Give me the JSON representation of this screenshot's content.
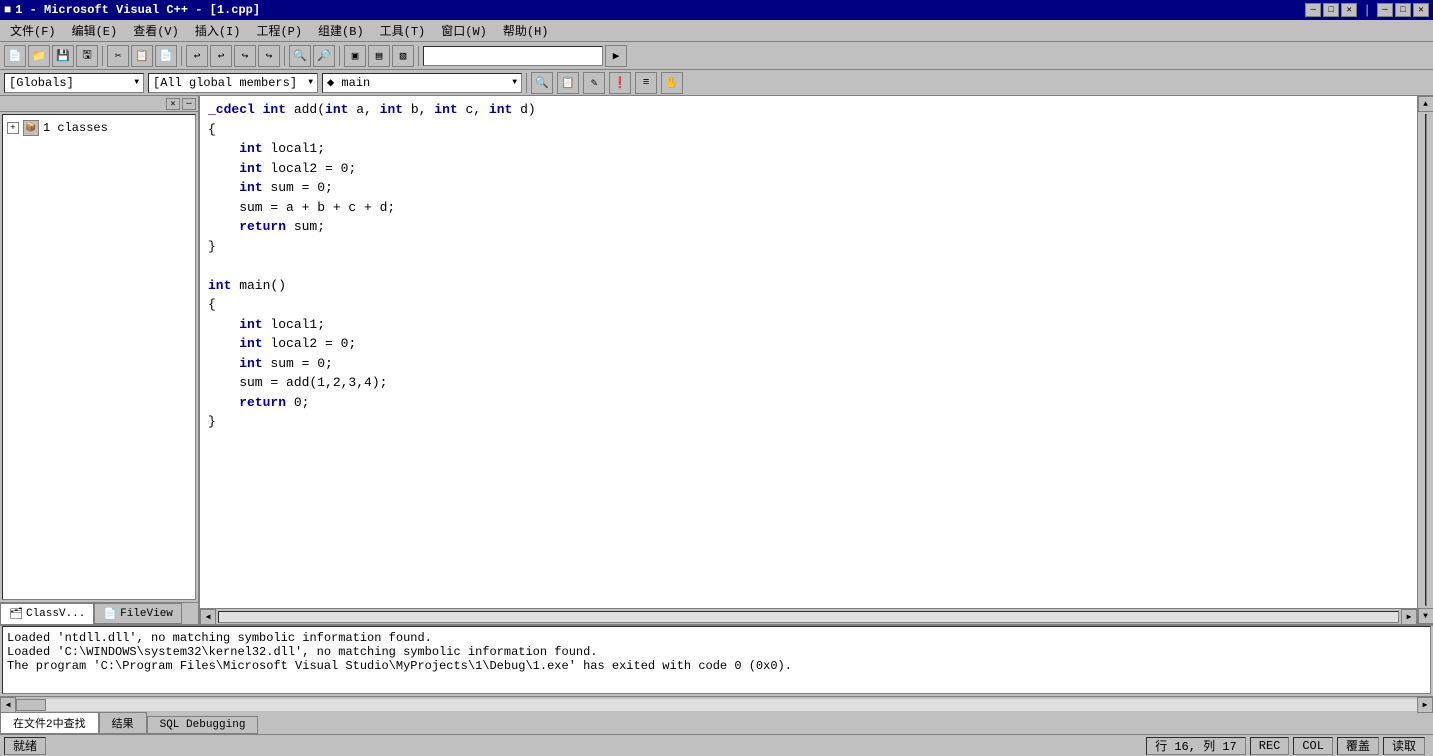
{
  "titlebar": {
    "icon": "■",
    "title": "1 - Microsoft Visual C++ - [1.cpp]",
    "min": "─",
    "max": "□",
    "close": "✕",
    "inner_min": "─",
    "inner_max": "□",
    "inner_close": "✕"
  },
  "menu": {
    "items": [
      "文件(F)",
      "编辑(E)",
      "查看(V)",
      "插入(I)",
      "工程(P)",
      "组建(B)",
      "工具(T)",
      "窗口(W)",
      "帮助(H)"
    ]
  },
  "toolbar": {
    "buttons": [
      "📄",
      "📁",
      "💾",
      "🖨",
      "✂",
      "📋",
      "📄",
      "↩",
      "↪",
      "🔍",
      "🔍",
      "🔲",
      "🔲",
      "🔲"
    ],
    "search_placeholder": ""
  },
  "toolbar2": {
    "globals_label": "[Globals]",
    "members_label": "[All global members]",
    "main_label": "◆ main",
    "buttons": [
      "🔍",
      "📋",
      "✏",
      "❗",
      "≡",
      "✋"
    ]
  },
  "leftpanel": {
    "tree_item": "1 classes",
    "expand_symbol": "+",
    "tabs": [
      "ClassV...",
      "FileView"
    ]
  },
  "code": {
    "lines": [
      "_cdecl int add(int a, int b, int c, int d)",
      "{",
      "    int local1;",
      "    int local2 = 0;",
      "    int sum = 0;",
      "    sum = a + b + c + d;",
      "    return sum;",
      "}",
      "",
      "int main()",
      "{",
      "    int local1;",
      "    int local2 = 0;",
      "    int sum = 0;",
      "    sum = add(1,2,3,4);",
      "    return 0;",
      "}"
    ]
  },
  "output": {
    "lines": [
      "Loaded 'ntdll.dll', no matching symbolic information found.",
      "Loaded 'C:\\WINDOWS\\system32\\kernel32.dll', no matching symbolic information found.",
      "The program 'C:\\Program Files\\Microsoft Visual Studio\\MyProjects\\1\\Debug\\1.exe' has exited with code 0 (0x0)."
    ],
    "tabs": [
      "在文件2中查找",
      "结果",
      "SQL Debugging"
    ]
  },
  "statusbar": {
    "ready": "就绪",
    "position": "行 16, 列 17",
    "rec": "REC",
    "col": "COL",
    "ovr": "覆盖",
    "read": "读取"
  }
}
